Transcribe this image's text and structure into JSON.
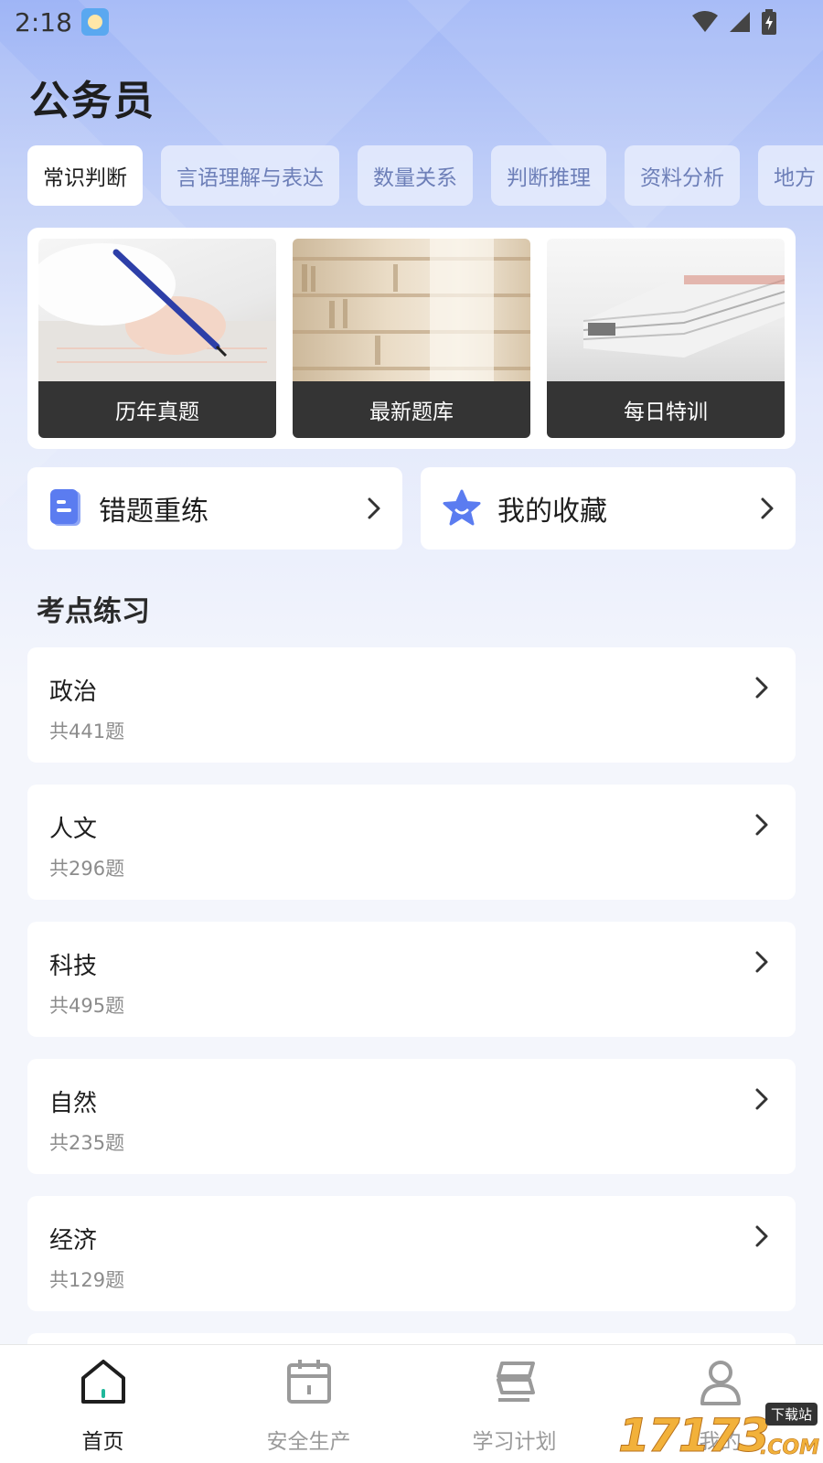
{
  "status_bar": {
    "time": "2:18"
  },
  "page_title": "公务员",
  "tabs": [
    {
      "label": "常识判断",
      "active": true
    },
    {
      "label": "言语理解与表达",
      "active": false
    },
    {
      "label": "数量关系",
      "active": false
    },
    {
      "label": "判断推理",
      "active": false
    },
    {
      "label": "资料分析",
      "active": false
    },
    {
      "label": "地方",
      "active": false
    }
  ],
  "feature_cards": [
    {
      "label": "历年真题",
      "image": "writing-hand-photo"
    },
    {
      "label": "最新题库",
      "image": "bookshelf-photo"
    },
    {
      "label": "每日特训",
      "image": "book-stack-photo"
    }
  ],
  "quick_actions": [
    {
      "label": "错题重练",
      "icon": "document-icon"
    },
    {
      "label": "我的收藏",
      "icon": "star-icon"
    }
  ],
  "section_title": "考点练习",
  "topics": [
    {
      "name": "政治",
      "count": "共441题"
    },
    {
      "name": "人文",
      "count": "共296题"
    },
    {
      "name": "科技",
      "count": "共495题"
    },
    {
      "name": "自然",
      "count": "共235题"
    },
    {
      "name": "经济",
      "count": "共129题"
    }
  ],
  "bottom_nav": [
    {
      "label": "首页",
      "icon": "home-icon",
      "active": true
    },
    {
      "label": "安全生产",
      "icon": "calendar-icon",
      "active": false
    },
    {
      "label": "学习计划",
      "icon": "plan-icon",
      "active": false
    },
    {
      "label": "我的",
      "icon": "profile-icon",
      "active": false
    }
  ],
  "watermark": {
    "main": "17173",
    "tag": "下载站",
    "suffix": ".COM"
  },
  "colors": {
    "accent": "#5b7cf0",
    "active_tab_bg": "#ffffff",
    "tab_text": "#6d7fb8",
    "card_label_bg": "#343434"
  }
}
